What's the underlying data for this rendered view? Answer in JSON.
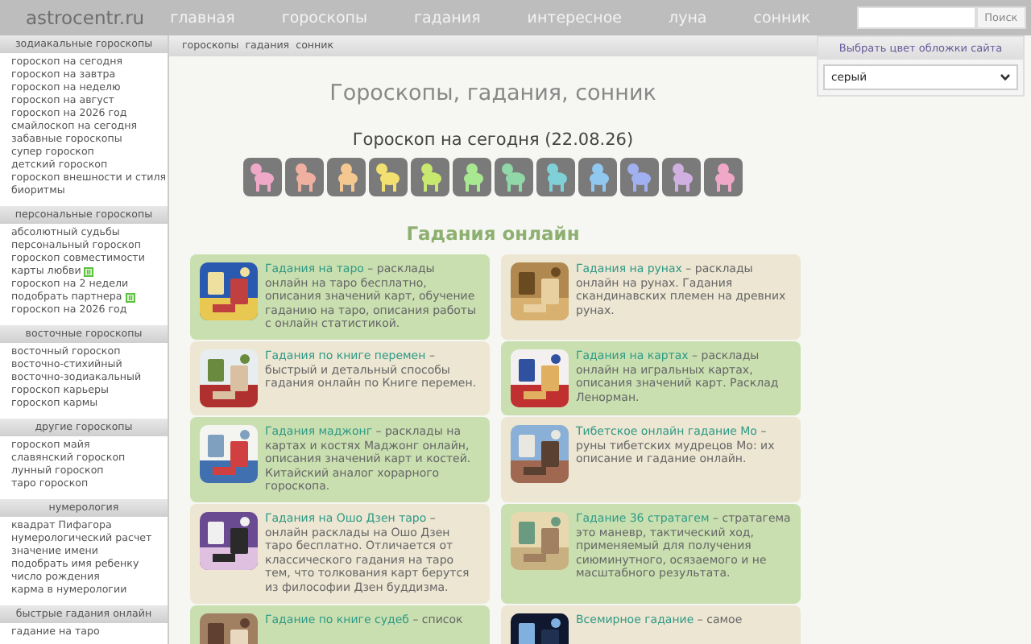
{
  "header": {
    "logo": "astrocentr.ru",
    "nav": [
      {
        "label": "главная"
      },
      {
        "label": "гороскопы"
      },
      {
        "label": "гадания"
      },
      {
        "label": "интересное"
      },
      {
        "label": "луна"
      },
      {
        "label": "сонник"
      }
    ],
    "search": {
      "button": "Поиск"
    }
  },
  "sidebar": [
    {
      "title": "зодиакальные гороскопы",
      "items": [
        {
          "label": "гороскоп на сегодня",
          "new": false
        },
        {
          "label": "гороскоп на завтра",
          "new": false
        },
        {
          "label": "гороскоп на неделю",
          "new": false
        },
        {
          "label": "гороскоп на август",
          "new": false
        },
        {
          "label": "гороскоп на 2026 год",
          "new": false
        },
        {
          "label": "смайлоскоп на сегодня",
          "new": false
        },
        {
          "label": "забавные гороскопы",
          "new": false
        },
        {
          "label": "супер гороскоп",
          "new": false
        },
        {
          "label": "детский гороскоп",
          "new": false
        },
        {
          "label": "гороскоп внешности и стиля",
          "new": false
        },
        {
          "label": "биоритмы",
          "new": false
        }
      ]
    },
    {
      "title": "персональные гороскопы",
      "items": [
        {
          "label": "абсолютный судьбы",
          "new": false
        },
        {
          "label": "персональный гороскоп",
          "new": false
        },
        {
          "label": "гороскоп совместимости",
          "new": false
        },
        {
          "label": "карты любви",
          "new": true
        },
        {
          "label": "гороскоп на 2 недели",
          "new": false
        },
        {
          "label": "подобрать партнера",
          "new": true
        },
        {
          "label": "гороскоп на 2026 год",
          "new": false
        }
      ]
    },
    {
      "title": "восточные гороскопы",
      "items": [
        {
          "label": "восточный гороскоп",
          "new": false
        },
        {
          "label": "восточно-стихийный",
          "new": false
        },
        {
          "label": "восточно-зодиакальный",
          "new": false
        },
        {
          "label": "гороскоп карьеры",
          "new": false
        },
        {
          "label": "гороскоп кармы",
          "new": false
        }
      ]
    },
    {
      "title": "другие гороскопы",
      "items": [
        {
          "label": "гороскоп майя",
          "new": false
        },
        {
          "label": "славянский гороскоп",
          "new": false
        },
        {
          "label": "лунный гороскоп",
          "new": false
        },
        {
          "label": "таро гороскоп",
          "new": false
        }
      ]
    },
    {
      "title": "нумерология",
      "items": [
        {
          "label": "квадрат Пифагора",
          "new": false
        },
        {
          "label": "нумерологический расчет",
          "new": false
        },
        {
          "label": "значение имени",
          "new": false
        },
        {
          "label": "подобрать имя ребенку",
          "new": false
        },
        {
          "label": "число рождения",
          "new": false
        },
        {
          "label": "карма в нумерологии",
          "new": false
        }
      ]
    },
    {
      "title": "быстрые гадания онлайн",
      "items": [
        {
          "label": "гадание на таро",
          "new": false
        }
      ]
    }
  ],
  "breadcrumb": [
    "гороскопы",
    "гадания",
    "сонник"
  ],
  "title": "Гороскопы, гадания, сонник",
  "today": "Гороскоп на сегодня (22.08.26)",
  "signs": [
    {
      "color": "#f0a8c8"
    },
    {
      "color": "#f0b0a0"
    },
    {
      "color": "#f4c890"
    },
    {
      "color": "#f2e070"
    },
    {
      "color": "#c8e870"
    },
    {
      "color": "#a8e890"
    },
    {
      "color": "#90d8a8"
    },
    {
      "color": "#80d0d8"
    },
    {
      "color": "#90c8f0"
    },
    {
      "color": "#a0b0f0"
    },
    {
      "color": "#d0b0e0"
    },
    {
      "color": "#f0a8c8"
    }
  ],
  "section": "Гадания онлайн",
  "cards": [
    {
      "title": "Гадания на таро",
      "text": "– расклады онлайн на таро бесплатно, описания значений карт, обучение гаданию на таро, описания работы с онлайн статистикой.",
      "color": "#c9dfb0"
    },
    {
      "title": "Гадания на рунах",
      "text": "– расклады онлайн на рунах. Гадания скандинавских племен на древних рунах.",
      "color": "#ece6d2"
    },
    {
      "title": "Гадания по книге перемен",
      "text": "– быстрый и детальный способы гадания онлайн по Книге перемен.",
      "color": "#ece6d2"
    },
    {
      "title": "Гадания на картах",
      "text": "– расклады онлайн на игральных картах, описания значений карт. Расклад Ленорман.",
      "color": "#c9dfb0"
    },
    {
      "title": "Гадания маджонг",
      "text": "– расклады на картах и костях Маджонг онлайн, описания значений карт и костей. Китайский аналог хорарного гороскопа.",
      "color": "#c9dfb0"
    },
    {
      "title": "Тибетское онлайн гадание Мо",
      "text": "– руны тибетских мудрецов Мо: их описание и гадание онлайн.",
      "color": "#ece6d2"
    },
    {
      "title": "Гадания на Ошо Дзен таро",
      "text": "– онлайн расклады на Ошо Дзен таро бесплатно. Отличается от классического гадания на таро тем, что толкования карт берутся из философии Дзен буддизма.",
      "color": "#ece6d2"
    },
    {
      "title": "Гадание 36 стратагем",
      "text": "– стратагема это маневр, тактический ход, применяемый для получения сиюминутного, осязаемого и не масштабного результата.",
      "color": "#c9dfb0"
    },
    {
      "title": "Гадание по книге судеб",
      "text": "– список",
      "color": "#c9dfb0"
    },
    {
      "title": "Всемирное гадание",
      "text": "– самое",
      "color": "#ece6d2"
    }
  ],
  "skin": {
    "title": "Выбрать цвет обложки сайта",
    "value": "серый"
  }
}
